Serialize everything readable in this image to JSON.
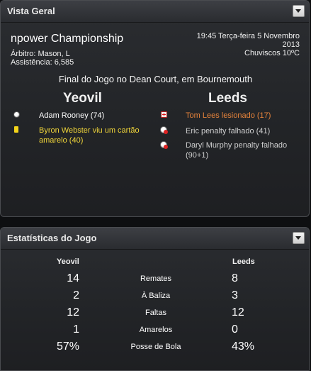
{
  "overview": {
    "title": "Vista Geral",
    "competition": "npower Championship",
    "referee": "Árbitro: Mason, L",
    "attendance": "Assistência: 6,585",
    "datetime": "19:45 Terça-feira 5 Novembro",
    "year": "2013",
    "weather": "Chuviscos 10ºC",
    "venue": "Final do Jogo no Dean Court, em Bournemouth",
    "home_team": "Yeovil",
    "away_team": "Leeds",
    "home_events": [
      {
        "icon": "goal-ball-icon",
        "line1": "Adam Rooney (74)",
        "line2": ""
      },
      {
        "icon": "yellow-card-icon",
        "line1": "Byron Webster viu um cartão",
        "line2": "amarelo (40)"
      }
    ],
    "away_events": [
      {
        "icon": "injury-cross-icon",
        "line1": "Tom Lees lesionado (17)",
        "line2": ""
      },
      {
        "icon": "missed-penalty-icon",
        "line1": "Eric penalty falhado (41)",
        "line2": ""
      },
      {
        "icon": "missed-penalty-icon",
        "line1": "Daryl Murphy penalty falhado",
        "line2": "(90+1)"
      }
    ]
  },
  "stats": {
    "title": "Estatísticas do Jogo",
    "home_team": "Yeovil",
    "away_team": "Leeds",
    "rows": [
      {
        "label": "Remates",
        "home": "14",
        "away": "8"
      },
      {
        "label": "À Baliza",
        "home": "2",
        "away": "3"
      },
      {
        "label": "Faltas",
        "home": "12",
        "away": "12"
      },
      {
        "label": "Amarelos",
        "home": "1",
        "away": "0"
      },
      {
        "label": "Posse de Bola",
        "home": "57%",
        "away": "43%"
      }
    ]
  },
  "colors": {
    "panel_bg": "#232528",
    "yellow_event": "#f0d53a",
    "injury_event": "#e8843b",
    "gray_event": "#cfcfcf"
  }
}
